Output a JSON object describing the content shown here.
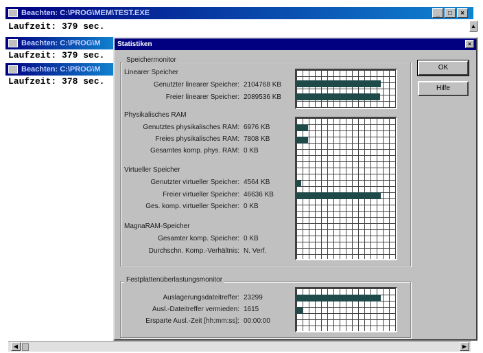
{
  "windows": [
    {
      "title": "Beachten: C:\\PROG\\MEM\\TEST.EXE",
      "runtime": "Laufzeit: 379 sec."
    },
    {
      "title": "Beachten: C:\\PROG\\M",
      "runtime": "Laufzeit: 379 sec."
    },
    {
      "title": "Beachten: C:\\PROG\\M",
      "runtime": "Laufzeit: 378 sec."
    }
  ],
  "window_controls": {
    "minimize": "_",
    "maximize": "□",
    "close": "×"
  },
  "dialog": {
    "title": "Statistiken",
    "close_label": "×",
    "ok_label": "OK",
    "help_label": "Hilfe",
    "section_monitor": "Speichermonitor",
    "linear": {
      "heading": "Linearer Speicher",
      "rows": [
        {
          "label": "Genutzter linearer Speicher:",
          "value": "2104768 KB"
        },
        {
          "label": "Freier linearer Speicher:",
          "value": "2089536 KB"
        }
      ]
    },
    "physical": {
      "heading": "Physikalisches RAM",
      "rows": [
        {
          "label": "Genutztes physikalisches RAM:",
          "value": "6976 KB"
        },
        {
          "label": "Freies physikalisches RAM:",
          "value": "7808 KB"
        },
        {
          "label": "Gesamtes komp. phys. RAM:",
          "value": "0 KB"
        }
      ]
    },
    "virtual": {
      "heading": "Virtueller Speicher",
      "rows": [
        {
          "label": "Genutzter virtueller Speicher:",
          "value": "4564 KB"
        },
        {
          "label": "Freier virtueller Speicher:",
          "value": "46636 KB"
        },
        {
          "label": "Ges. komp. virtueller Speicher:",
          "value": "0 KB"
        }
      ]
    },
    "magnaram": {
      "heading": "MagnaRAM-Speicher",
      "rows": [
        {
          "label": "Gesamter komp. Speicher:",
          "value": "0 KB"
        },
        {
          "label": "Durchschn. Komp.-Verhältnis:",
          "value": "N. Verf."
        }
      ]
    },
    "disk": {
      "heading": "Festplattenüberlastungsmonitor",
      "rows": [
        {
          "label": "Auslagerungsdateitreffer:",
          "value": "23299"
        },
        {
          "label": "Ausl.-Dateitreffer vermieden:",
          "value": "1615"
        },
        {
          "label": "Ersparte Ausl.-Zeit [hh:mm:ss]:",
          "value": "00:00:00"
        }
      ]
    },
    "usage_fractions": {
      "linear_used": 0.85,
      "linear_free": 0.84,
      "physical_used": 0.12,
      "physical_free": 0.12,
      "virtual_used": 0.05,
      "virtual_free": 0.85,
      "disk_hits": 0.85,
      "disk_avoided": 0.06
    }
  }
}
